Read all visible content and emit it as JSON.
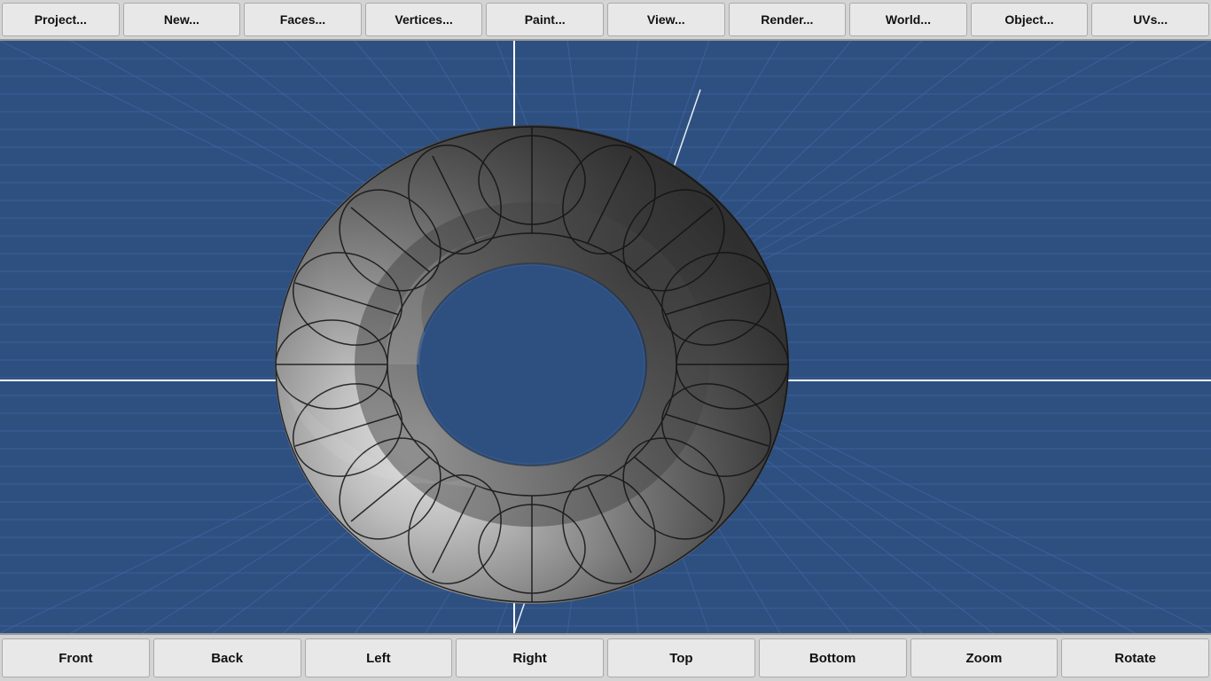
{
  "topMenu": {
    "buttons": [
      {
        "label": "Project...",
        "name": "project-btn"
      },
      {
        "label": "New...",
        "name": "new-btn"
      },
      {
        "label": "Faces...",
        "name": "faces-btn"
      },
      {
        "label": "Vertices...",
        "name": "vertices-btn"
      },
      {
        "label": "Paint...",
        "name": "paint-btn"
      },
      {
        "label": "View...",
        "name": "view-btn"
      },
      {
        "label": "Render...",
        "name": "render-btn"
      },
      {
        "label": "World...",
        "name": "world-btn"
      },
      {
        "label": "Object...",
        "name": "object-btn"
      },
      {
        "label": "UVs...",
        "name": "uvs-btn"
      }
    ]
  },
  "bottomMenu": {
    "buttons": [
      {
        "label": "Front",
        "name": "front-btn"
      },
      {
        "label": "Back",
        "name": "back-btn"
      },
      {
        "label": "Left",
        "name": "left-btn"
      },
      {
        "label": "Right",
        "name": "right-btn"
      },
      {
        "label": "Top",
        "name": "top-btn"
      },
      {
        "label": "Bottom",
        "name": "bottom-btn"
      },
      {
        "label": "Zoom",
        "name": "zoom-btn"
      },
      {
        "label": "Rotate",
        "name": "rotate-btn"
      }
    ]
  },
  "viewport": {
    "backgroundColor": "#2e4f8a",
    "gridColor": "#4a6aaa"
  }
}
